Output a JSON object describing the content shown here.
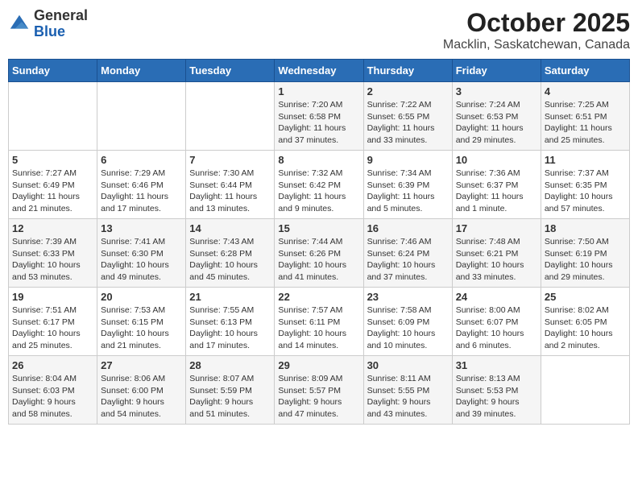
{
  "title": "October 2025",
  "subtitle": "Macklin, Saskatchewan, Canada",
  "logo": {
    "line1": "General",
    "line2": "Blue"
  },
  "days_of_week": [
    "Sunday",
    "Monday",
    "Tuesday",
    "Wednesday",
    "Thursday",
    "Friday",
    "Saturday"
  ],
  "weeks": [
    [
      {
        "date": "",
        "info": ""
      },
      {
        "date": "",
        "info": ""
      },
      {
        "date": "",
        "info": ""
      },
      {
        "date": "1",
        "info": "Sunrise: 7:20 AM\nSunset: 6:58 PM\nDaylight: 11 hours\nand 37 minutes."
      },
      {
        "date": "2",
        "info": "Sunrise: 7:22 AM\nSunset: 6:55 PM\nDaylight: 11 hours\nand 33 minutes."
      },
      {
        "date": "3",
        "info": "Sunrise: 7:24 AM\nSunset: 6:53 PM\nDaylight: 11 hours\nand 29 minutes."
      },
      {
        "date": "4",
        "info": "Sunrise: 7:25 AM\nSunset: 6:51 PM\nDaylight: 11 hours\nand 25 minutes."
      }
    ],
    [
      {
        "date": "5",
        "info": "Sunrise: 7:27 AM\nSunset: 6:49 PM\nDaylight: 11 hours\nand 21 minutes."
      },
      {
        "date": "6",
        "info": "Sunrise: 7:29 AM\nSunset: 6:46 PM\nDaylight: 11 hours\nand 17 minutes."
      },
      {
        "date": "7",
        "info": "Sunrise: 7:30 AM\nSunset: 6:44 PM\nDaylight: 11 hours\nand 13 minutes."
      },
      {
        "date": "8",
        "info": "Sunrise: 7:32 AM\nSunset: 6:42 PM\nDaylight: 11 hours\nand 9 minutes."
      },
      {
        "date": "9",
        "info": "Sunrise: 7:34 AM\nSunset: 6:39 PM\nDaylight: 11 hours\nand 5 minutes."
      },
      {
        "date": "10",
        "info": "Sunrise: 7:36 AM\nSunset: 6:37 PM\nDaylight: 11 hours\nand 1 minute."
      },
      {
        "date": "11",
        "info": "Sunrise: 7:37 AM\nSunset: 6:35 PM\nDaylight: 10 hours\nand 57 minutes."
      }
    ],
    [
      {
        "date": "12",
        "info": "Sunrise: 7:39 AM\nSunset: 6:33 PM\nDaylight: 10 hours\nand 53 minutes."
      },
      {
        "date": "13",
        "info": "Sunrise: 7:41 AM\nSunset: 6:30 PM\nDaylight: 10 hours\nand 49 minutes."
      },
      {
        "date": "14",
        "info": "Sunrise: 7:43 AM\nSunset: 6:28 PM\nDaylight: 10 hours\nand 45 minutes."
      },
      {
        "date": "15",
        "info": "Sunrise: 7:44 AM\nSunset: 6:26 PM\nDaylight: 10 hours\nand 41 minutes."
      },
      {
        "date": "16",
        "info": "Sunrise: 7:46 AM\nSunset: 6:24 PM\nDaylight: 10 hours\nand 37 minutes."
      },
      {
        "date": "17",
        "info": "Sunrise: 7:48 AM\nSunset: 6:21 PM\nDaylight: 10 hours\nand 33 minutes."
      },
      {
        "date": "18",
        "info": "Sunrise: 7:50 AM\nSunset: 6:19 PM\nDaylight: 10 hours\nand 29 minutes."
      }
    ],
    [
      {
        "date": "19",
        "info": "Sunrise: 7:51 AM\nSunset: 6:17 PM\nDaylight: 10 hours\nand 25 minutes."
      },
      {
        "date": "20",
        "info": "Sunrise: 7:53 AM\nSunset: 6:15 PM\nDaylight: 10 hours\nand 21 minutes."
      },
      {
        "date": "21",
        "info": "Sunrise: 7:55 AM\nSunset: 6:13 PM\nDaylight: 10 hours\nand 17 minutes."
      },
      {
        "date": "22",
        "info": "Sunrise: 7:57 AM\nSunset: 6:11 PM\nDaylight: 10 hours\nand 14 minutes."
      },
      {
        "date": "23",
        "info": "Sunrise: 7:58 AM\nSunset: 6:09 PM\nDaylight: 10 hours\nand 10 minutes."
      },
      {
        "date": "24",
        "info": "Sunrise: 8:00 AM\nSunset: 6:07 PM\nDaylight: 10 hours\nand 6 minutes."
      },
      {
        "date": "25",
        "info": "Sunrise: 8:02 AM\nSunset: 6:05 PM\nDaylight: 10 hours\nand 2 minutes."
      }
    ],
    [
      {
        "date": "26",
        "info": "Sunrise: 8:04 AM\nSunset: 6:03 PM\nDaylight: 9 hours\nand 58 minutes."
      },
      {
        "date": "27",
        "info": "Sunrise: 8:06 AM\nSunset: 6:00 PM\nDaylight: 9 hours\nand 54 minutes."
      },
      {
        "date": "28",
        "info": "Sunrise: 8:07 AM\nSunset: 5:59 PM\nDaylight: 9 hours\nand 51 minutes."
      },
      {
        "date": "29",
        "info": "Sunrise: 8:09 AM\nSunset: 5:57 PM\nDaylight: 9 hours\nand 47 minutes."
      },
      {
        "date": "30",
        "info": "Sunrise: 8:11 AM\nSunset: 5:55 PM\nDaylight: 9 hours\nand 43 minutes."
      },
      {
        "date": "31",
        "info": "Sunrise: 8:13 AM\nSunset: 5:53 PM\nDaylight: 9 hours\nand 39 minutes."
      },
      {
        "date": "",
        "info": ""
      }
    ]
  ]
}
